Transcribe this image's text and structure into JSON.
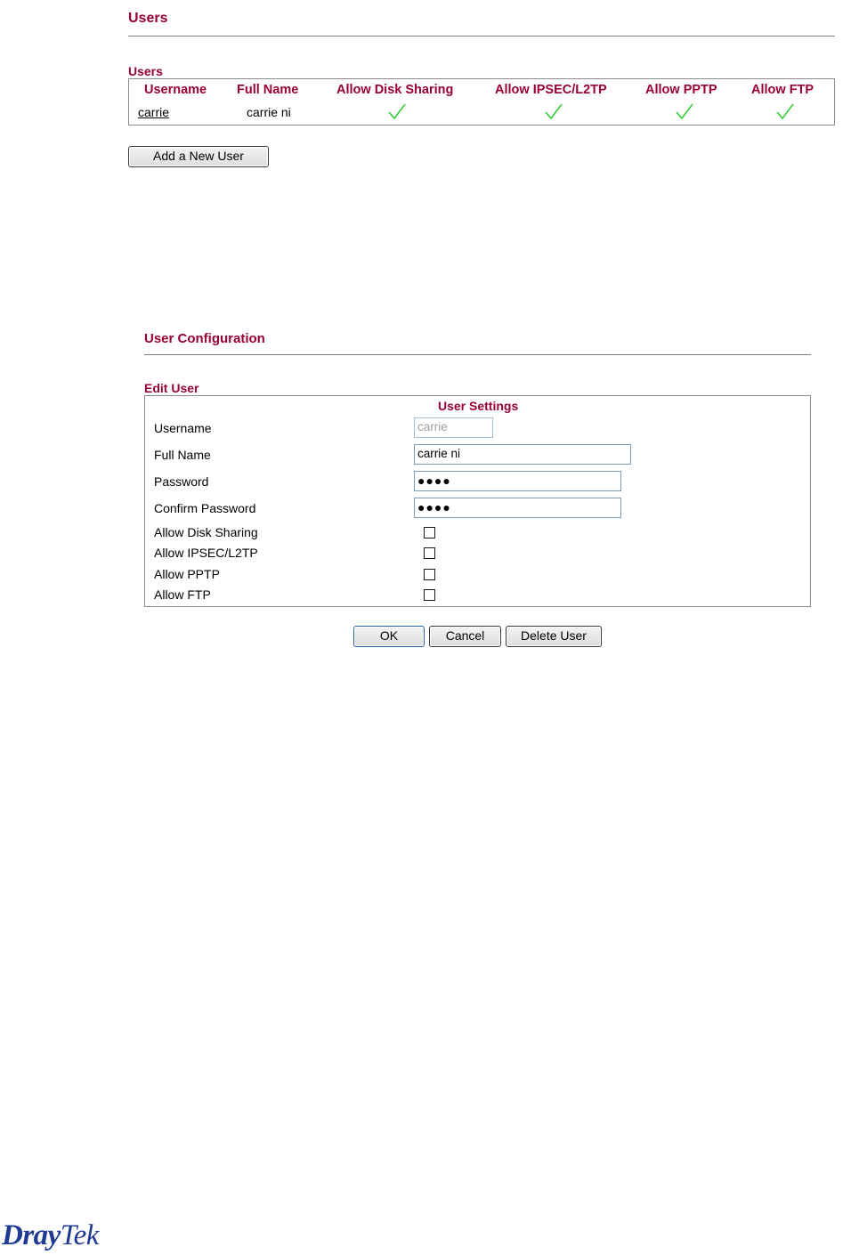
{
  "users_page": {
    "title": "Users",
    "table_caption": "Users",
    "columns": [
      "Username",
      "Full Name",
      "Allow Disk Sharing",
      "Allow IPSEC/L2TP",
      "Allow PPTP",
      "Allow FTP"
    ],
    "rows": [
      {
        "username": "carrie",
        "full_name": "carrie ni",
        "disk_sharing": true,
        "ipsec_l2tp": true,
        "pptp": true,
        "ftp": true
      }
    ],
    "add_button": "Add a New User"
  },
  "config_page": {
    "title": "User Configuration",
    "edit_caption": "Edit User",
    "settings_header": "User Settings",
    "fields": {
      "username_label": "Username",
      "username_value": "carrie",
      "fullname_label": "Full Name",
      "fullname_value": "carrie ni",
      "password_label": "Password",
      "password_value": "●●●●",
      "confirm_label": "Confirm Password",
      "confirm_value": "●●●●",
      "disk_label": "Allow Disk Sharing",
      "disk_checked": false,
      "ipsec_label": "Allow IPSEC/L2TP",
      "ipsec_checked": false,
      "pptp_label": "Allow PPTP",
      "pptp_checked": false,
      "ftp_label": "Allow FTP",
      "ftp_checked": false
    },
    "buttons": {
      "ok": "OK",
      "cancel": "Cancel",
      "delete": "Delete User"
    }
  },
  "brand": {
    "logo_part1": "Dray",
    "logo_part2": "Tek"
  },
  "colors": {
    "heading": "#990033",
    "check": "#33cc33",
    "logo": "#1f3a93"
  }
}
